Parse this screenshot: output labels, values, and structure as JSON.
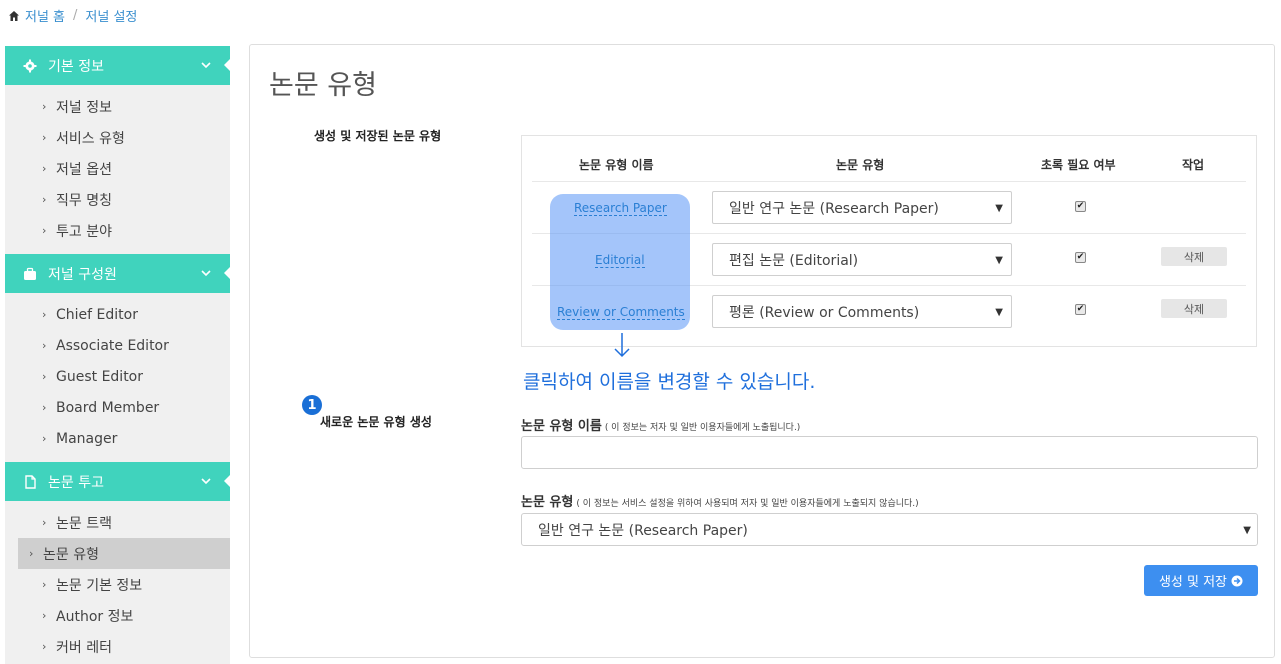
{
  "breadcrumb": {
    "home": "저널 홈",
    "current": "저널 설정"
  },
  "sidebar": {
    "sections": [
      {
        "title": "기본 정보",
        "icon": "gear-icon",
        "items": [
          "저널 정보",
          "서비스 유형",
          "저널 옵션",
          "직무 명칭",
          "투고 분야"
        ]
      },
      {
        "title": "저널 구성원",
        "icon": "briefcase-icon",
        "items": [
          "Chief Editor",
          "Associate Editor",
          "Guest Editor",
          "Board Member",
          "Manager"
        ]
      },
      {
        "title": "논문 투고",
        "icon": "document-icon",
        "items": [
          "논문 트랙",
          "논문 유형",
          "논문 기본 정보",
          "Author 정보",
          "커버 레터"
        ]
      }
    ],
    "active_item": "논문 유형"
  },
  "main": {
    "title": "논문 유형",
    "saved_label": "생성 및 저장된 논문 유형",
    "new_label": "새로운 논문 유형 생성",
    "step_number": "1",
    "table": {
      "headers": [
        "논문 유형 이름",
        "논문 유형",
        "초록 필요 여부",
        "작업"
      ],
      "rows": [
        {
          "name": "Research Paper",
          "type": "일반 연구 논문 (Research Paper)",
          "abstract_required": true,
          "action": ""
        },
        {
          "name": "Editorial",
          "type": "편집 논문 (Editorial)",
          "abstract_required": true,
          "action": "삭제"
        },
        {
          "name": "Review or Comments",
          "type": "평론 (Review or Comments)",
          "abstract_required": true,
          "action": "삭제"
        }
      ]
    },
    "hint": "클릭하여 이름을 변경할 수 있습니다.",
    "form": {
      "name_label": "논문 유형 이름",
      "name_note": "( 이 정보는 저자 및 일반 이용자들에게 노출됩니다.)",
      "name_value": "",
      "type_label": "논문 유형",
      "type_note": "( 이 정보는 서비스 설정을 위하여 사용되며 저자 및 일반 이용자들에게 노출되지 않습니다.)",
      "type_value": "일반 연구 논문 (Research Paper)",
      "submit_label": "생성 및 저장"
    }
  },
  "colors": {
    "accent": "#40d3bd",
    "primary": "#3d8ff0",
    "link": "#2a7fd4",
    "hint": "#1f6fdc"
  }
}
